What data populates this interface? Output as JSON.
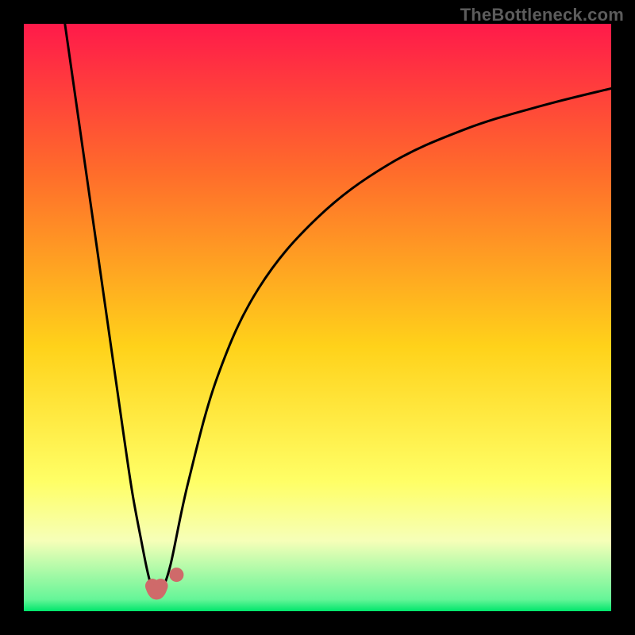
{
  "watermark": "TheBottleneck.com",
  "colors": {
    "frame": "#000000",
    "gradient_top": "#ff1a4a",
    "gradient_mid1": "#ff6b2b",
    "gradient_mid2": "#ffd21a",
    "gradient_mid3": "#ffff66",
    "gradient_mid4": "#f6ffb8",
    "gradient_bottom": "#00e66b",
    "curve": "#000000",
    "marker": "#cf6a6a"
  },
  "chart_data": {
    "type": "line",
    "title": "",
    "xlabel": "",
    "ylabel": "",
    "xlim": [
      0,
      100
    ],
    "ylim": [
      0,
      100
    ],
    "series": [
      {
        "name": "left-branch",
        "x": [
          7,
          9,
          11,
          13,
          15,
          17,
          18.5,
          20,
          21,
          21.8,
          22.3
        ],
        "y": [
          100,
          86,
          72,
          58,
          44,
          30,
          20,
          12,
          7,
          4,
          3.5
        ]
      },
      {
        "name": "right-branch",
        "x": [
          23.5,
          25,
          28,
          33,
          40,
          50,
          62,
          75,
          88,
          100
        ],
        "y": [
          3.5,
          8,
          22,
          40,
          55,
          67,
          76,
          82,
          86,
          89
        ]
      }
    ],
    "markers": [
      {
        "name": "valley-u-left",
        "x": 21.9,
        "y": 4.3
      },
      {
        "name": "valley-u-mid",
        "x": 22.6,
        "y": 3.4
      },
      {
        "name": "valley-u-right",
        "x": 23.3,
        "y": 4.3
      },
      {
        "name": "valley-dot",
        "x": 26.0,
        "y": 6.2
      }
    ]
  }
}
